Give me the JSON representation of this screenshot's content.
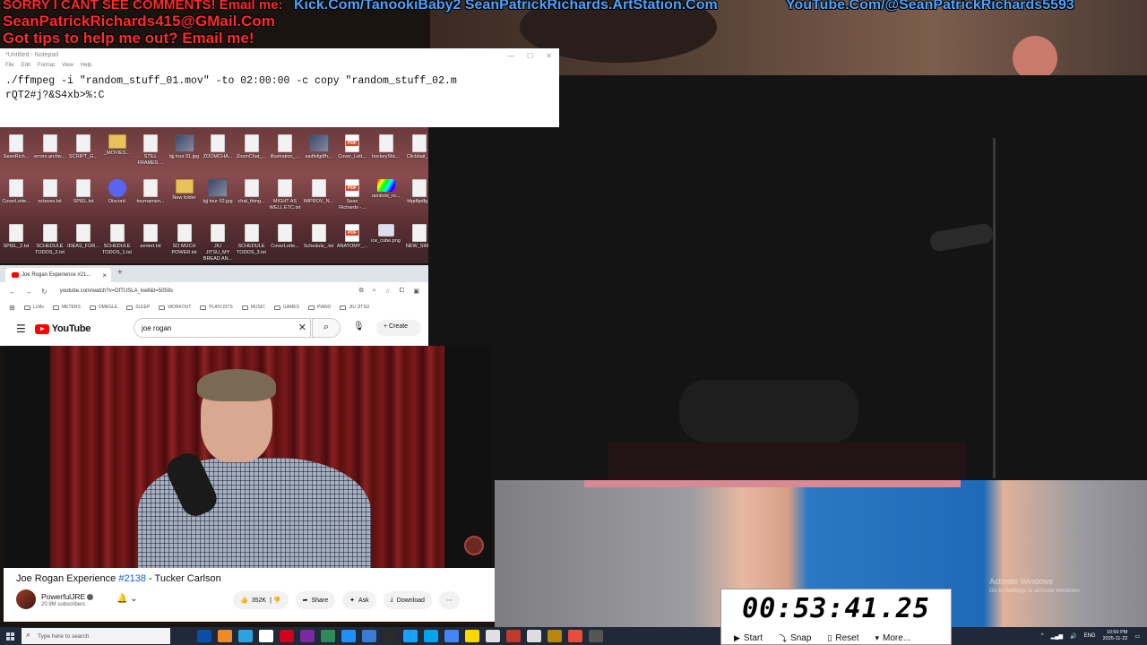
{
  "overlay": {
    "line1_red": "SORRY I CANT SEE COMMENTS! Email me:",
    "line1_blue": "Kick.Com/TanookiBaby2 SeanPatrickRichards.ArtStation.Com",
    "line1_blue2": "YouTube.Com/@SeanPatrickRichards5593",
    "line2_red": "SeanPatrickRichards415@GMail.Com",
    "line3_red": "Got tips to help me out? Email me!",
    "colors": {
      "red": "#ff2a2a",
      "blue": "#4da3ff"
    }
  },
  "notepad": {
    "title": "*Untitled - Notepad",
    "menu": [
      "File",
      "Edit",
      "Format",
      "View",
      "Help"
    ],
    "line1": "./ffmpeg -i \"random_stuff_01.mov\" -to 02:00:00 -c copy \"random_stuff_02.m",
    "line2": "rQT2#j?&S4xb>%:C"
  },
  "desktop": {
    "icons": [
      {
        "label": "SeanRich...",
        "type": "txt"
      },
      {
        "label": "errors.archiv...",
        "type": "txt"
      },
      {
        "label": "SCRIPT_G...",
        "type": "txt"
      },
      {
        "label": "_MOVIES...",
        "type": "folder"
      },
      {
        "label": "STILL FRAMES ...",
        "type": "txt"
      },
      {
        "label": "bjj tour 01.jpg",
        "type": "img"
      },
      {
        "label": "ZOOMCHA...",
        "type": "txt"
      },
      {
        "label": "ZoomChat_...",
        "type": "txt"
      },
      {
        "label": "illustration_...",
        "type": "txt"
      },
      {
        "label": "sadfsfgdfh...",
        "type": "img"
      },
      {
        "label": "Cover_Lett...",
        "type": "pdf"
      },
      {
        "label": "hockeyStic...",
        "type": "txt"
      },
      {
        "label": "Clickbait_...",
        "type": "txt"
      },
      {
        "label": "CoverLette...",
        "type": "txt"
      },
      {
        "label": "octaves.txt",
        "type": "txt"
      },
      {
        "label": "SPIEL.txt",
        "type": "txt"
      },
      {
        "label": "Discord",
        "type": "discord"
      },
      {
        "label": "tournamen...",
        "type": "txt"
      },
      {
        "label": "New folder",
        "type": "folder"
      },
      {
        "label": "bjj tour 02.jpg",
        "type": "img"
      },
      {
        "label": "chat_thing...",
        "type": "txt"
      },
      {
        "label": "MIGHT AS WELL ETC.txt",
        "type": "txt"
      },
      {
        "label": "IMPROV_N...",
        "type": "txt"
      },
      {
        "label": "Sean Richards -...",
        "type": "pdf"
      },
      {
        "label": "rainbow_ro...",
        "type": "prism"
      },
      {
        "label": "fdgdfgdfg...",
        "type": "txt"
      },
      {
        "label": "SPIEL_2.txt",
        "type": "txt"
      },
      {
        "label": "SCHEDULE TODOS_2.txt",
        "type": "txt"
      },
      {
        "label": "IDEAS_FOR...",
        "type": "txt"
      },
      {
        "label": "SCHEDULE TODOS_1.txt",
        "type": "txt"
      },
      {
        "label": "eertert.txt",
        "type": "txt"
      },
      {
        "label": "SO MUCH POWER.txt",
        "type": "txt"
      },
      {
        "label": "JIU JITSU_MY BREAD AN...",
        "type": "txt"
      },
      {
        "label": "SCHEDULE TODOS_3.txt",
        "type": "txt"
      },
      {
        "label": "CoverLette...",
        "type": "txt"
      },
      {
        "label": "Schedule_.txt",
        "type": "txt"
      },
      {
        "label": "ANATOMY_...",
        "type": "pdf"
      },
      {
        "label": "ice_cube.png",
        "type": "cube"
      },
      {
        "label": "NEW_SIM...",
        "type": "txt"
      }
    ]
  },
  "browser": {
    "tab_title": "Joe Rogan Experience #21...",
    "url": "youtube.com/watch?v=DfTUSLA_kw8&t=5059s",
    "bookmarks": [
      "LLMs",
      "METERS",
      "OMEGLE",
      "SLEEP",
      "WORKOUT",
      "PLAYLISTS",
      "MUSIC",
      "GAMES",
      "PIANO",
      "JIU JITSU"
    ],
    "youtube_logo": "YouTube",
    "search_value": "joe rogan",
    "create_label": "Create"
  },
  "video": {
    "title_prefix": "Joe Rogan Experience ",
    "episode": "#2138",
    "title_suffix": " - Tucker Carlson",
    "channel": "PowerfulJRE",
    "subscribers": "20.9M subscribers",
    "likes": "352K",
    "share_label": "Share",
    "ask_label": "Ask",
    "download_label": "Download"
  },
  "watermark": {
    "title": "Activate Windows",
    "subtitle": "Go to Settings to activate Windows."
  },
  "timer": {
    "value": "00:53:41.25",
    "start_label": "Start",
    "snap_label": "Snap",
    "reset_label": "Reset",
    "more_label": "More..."
  },
  "taskbar": {
    "search_placeholder": "Type here to search",
    "lang": "ENG",
    "time": "10:50 PM",
    "date": "2025-11-22"
  }
}
